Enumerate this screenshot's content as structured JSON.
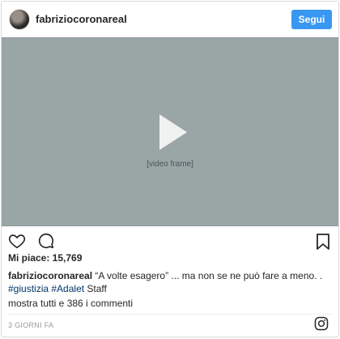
{
  "header": {
    "username": "fabriziocoronareal",
    "follow_label": "Segui"
  },
  "media": {
    "type": "video",
    "placeholder_label": "[video frame]"
  },
  "icons": {
    "like": "heart-icon",
    "comment": "comment-icon",
    "save": "bookmark-icon",
    "play": "play-icon",
    "logo": "instagram-icon"
  },
  "likes": "Mi piace: 15,769",
  "caption": {
    "username": "fabriziocoronareal",
    "text": "“A volte esagero” ... ma non se ne può fare a meno. .",
    "tag1": "#giustizia",
    "tag2": "#Adalet",
    "suffix": "Staff"
  },
  "comments_link": "mostra tutti e 386 i commenti",
  "date": "3 GIORNI FA",
  "colors": {
    "accent": "#3897f0",
    "hashtag": "#003569",
    "muted": "#999999"
  }
}
